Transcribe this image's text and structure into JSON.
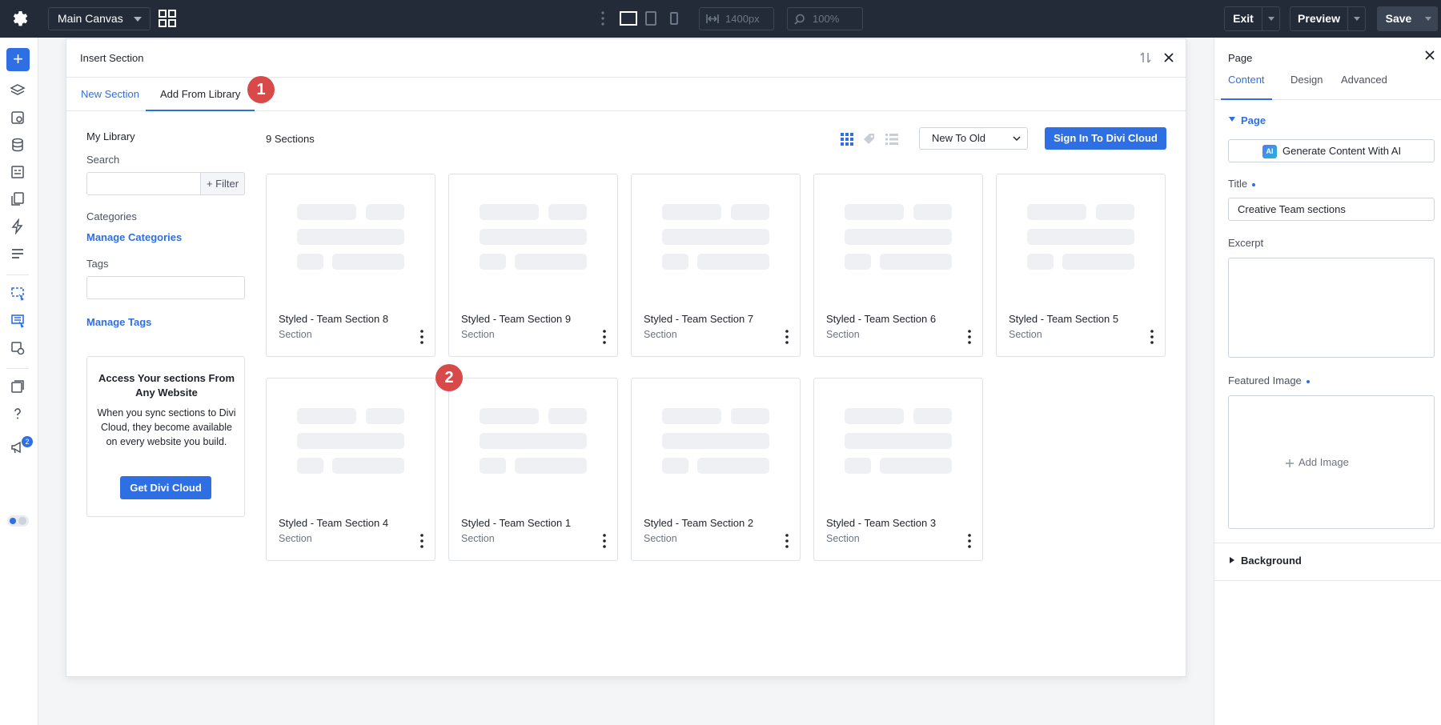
{
  "topbar": {
    "canvas_label": "Main Canvas",
    "width_value": "1400px",
    "zoom_value": "100%",
    "exit_label": "Exit",
    "preview_label": "Preview",
    "save_label": "Save"
  },
  "leftbar": {
    "add_label": "+",
    "notifications_count": "2"
  },
  "modal": {
    "title": "Insert Section",
    "tabs": [
      {
        "label": "New Section"
      },
      {
        "label": "Add From Library"
      }
    ],
    "step_markers": [
      "1",
      "2"
    ]
  },
  "library": {
    "heading": "My Library",
    "search_label": "Search",
    "filter_label": "+ Filter",
    "categories_label": "Categories",
    "manage_categories": "Manage Categories",
    "tags_label": "Tags",
    "manage_tags": "Manage Tags",
    "cloud_title": "Access Your sections From Any Website",
    "cloud_text": "When you sync sections to Divi Cloud, they become available on every website you build.",
    "cloud_button": "Get Divi Cloud"
  },
  "grid": {
    "count_label": "9 Sections",
    "sort_value": "New To Old",
    "signin_label": "Sign In To Divi Cloud",
    "items": [
      {
        "name": "Styled - Team Section 8",
        "type": "Section"
      },
      {
        "name": "Styled - Team Section 9",
        "type": "Section"
      },
      {
        "name": "Styled - Team Section 7",
        "type": "Section"
      },
      {
        "name": "Styled - Team Section 6",
        "type": "Section"
      },
      {
        "name": "Styled - Team Section 5",
        "type": "Section"
      },
      {
        "name": "Styled - Team Section 4",
        "type": "Section"
      },
      {
        "name": "Styled - Team Section 1",
        "type": "Section"
      },
      {
        "name": "Styled - Team Section 2",
        "type": "Section"
      },
      {
        "name": "Styled - Team Section 3",
        "type": "Section"
      }
    ]
  },
  "panel": {
    "title": "Page",
    "tabs": [
      {
        "label": "Content"
      },
      {
        "label": "Design"
      },
      {
        "label": "Advanced"
      }
    ],
    "section_page": "Page",
    "ai_badge": "AI",
    "ai_button": "Generate Content With AI",
    "title_label": "Title",
    "title_value": "Creative Team sections",
    "excerpt_label": "Excerpt",
    "featured_label": "Featured Image",
    "add_image": "Add Image",
    "section_background": "Background"
  },
  "colors": {
    "accent": "#2f6fe4",
    "topbar": "#232b38",
    "step_marker": "#d8494a"
  }
}
